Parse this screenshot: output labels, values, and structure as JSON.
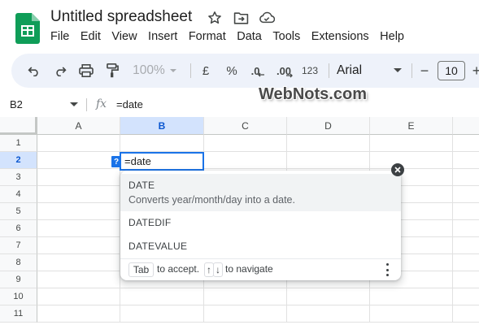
{
  "doc": {
    "title": "Untitled spreadsheet"
  },
  "menu": [
    "File",
    "Edit",
    "View",
    "Insert",
    "Format",
    "Data",
    "Tools",
    "Extensions",
    "Help"
  ],
  "toolbar": {
    "zoom": "100%",
    "currency": "£",
    "percent": "%",
    "decrease_decimal": ".0",
    "increase_decimal": ".00",
    "number_format": "123",
    "font": "Arial",
    "font_size": "10",
    "minus": "−",
    "plus": "+"
  },
  "watermark": "WebNots.com",
  "formula_bar": {
    "cell_ref": "B2",
    "fx": "fx",
    "formula": "=date"
  },
  "grid": {
    "columns": [
      "A",
      "B",
      "C",
      "D",
      "E"
    ],
    "rows": [
      "1",
      "2",
      "3",
      "4",
      "5",
      "6",
      "7",
      "8",
      "9",
      "10",
      "11"
    ],
    "selected_column": "B",
    "selected_row": "2"
  },
  "active_cell": {
    "value": "=date",
    "help_marker": "?"
  },
  "autocomplete": {
    "suggestions": [
      {
        "name": "DATE",
        "description": "Converts year/month/day into a date."
      },
      {
        "name": "DATEDIF"
      },
      {
        "name": "DATEVALUE"
      }
    ],
    "footer": {
      "tab_key": "Tab",
      "accept_text": "to accept.",
      "up_key": "↑",
      "down_key": "↓",
      "navigate_text": "to navigate"
    }
  },
  "colors": {
    "accent": "#1a73e8",
    "sheets_green": "#0f9d58",
    "toolbar_bg": "#eef2fa",
    "selected_header": "#d3e3fd"
  }
}
